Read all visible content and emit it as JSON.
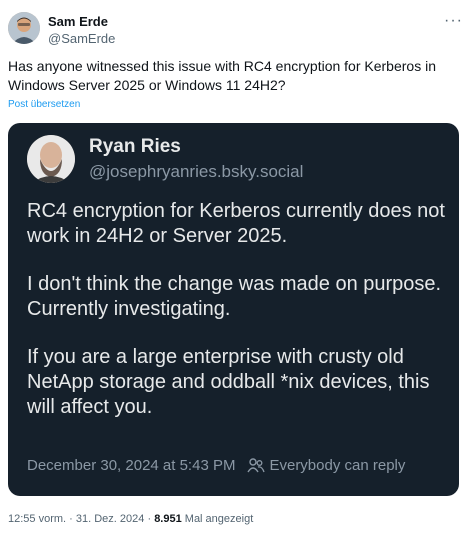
{
  "post": {
    "author_name": "Sam Erde",
    "author_handle": "@SamErde",
    "more_icon": "ellipsis-icon",
    "text": "Has anyone witnessed this issue with RC4 encryption for Kerberos in Windows Server 2025 or Windows 11 24H2?",
    "translate_label": "Post übersetzen",
    "time": "12:55 vorm.",
    "separator": "·",
    "date": "31. Dez. 2024",
    "views_count": "8.951",
    "views_label": "Mal angezeigt"
  },
  "embed": {
    "author_name": "Ryan Ries",
    "author_handle": "@josephryanries.bsky.social",
    "paragraphs": [
      "RC4 encryption for Kerberos currently does not work in 24H2 or Server 2025.",
      "I don't think the change was made on purpose. Currently investigating.",
      "If you are a large enterprise with crusty old NetApp storage and oddball *nix devices, this will affect you."
    ],
    "timestamp": "December 30, 2024 at 5:43 PM",
    "reply_icon": "people-icon",
    "reply_setting": "Everybody can reply"
  },
  "colors": {
    "card_background": "#15202b",
    "link_blue": "#1d9bf0"
  }
}
